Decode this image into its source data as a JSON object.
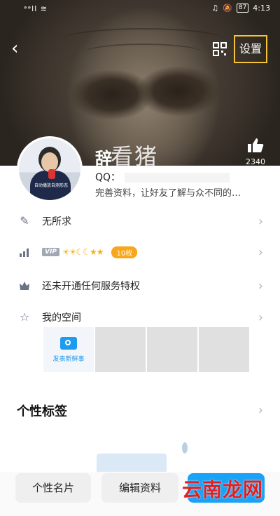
{
  "status_bar": {
    "left": "ᵊᵊll ≋",
    "time": "4:13",
    "battery": "87"
  },
  "header": {
    "settings_label": "设置",
    "nickname": "辞",
    "nickname_overlay": "看猪",
    "like_count": "2340"
  },
  "profile": {
    "qq_label": "QQ：",
    "signature": "完善资料，让好友了解与众不同的…",
    "avatar_caption": "自动播放自测形态"
  },
  "rows": [
    {
      "id": "mood",
      "label": "无所求",
      "icon": "edit-icon"
    },
    {
      "id": "vip",
      "vip_tag": "VIP",
      "level_icons": "☀☀☾☾★★",
      "coin_label": "10枚",
      "icon": "growth-icon"
    },
    {
      "id": "privilege",
      "label": "还未开通任何服务特权",
      "icon": "crown-icon"
    },
    {
      "id": "space",
      "label": "我的空间",
      "icon": "star-icon"
    }
  ],
  "space": {
    "post_label": "发表新鲜事"
  },
  "tags_section": {
    "title": "个性标签"
  },
  "bottom_bar": {
    "card_label": "个性名片",
    "edit_label": "编辑资料"
  },
  "watermark": "云南龙网",
  "colors": {
    "accent": "#1aa2f7",
    "settings_highlight": "#f6c236",
    "coin": "#f8a61c"
  }
}
